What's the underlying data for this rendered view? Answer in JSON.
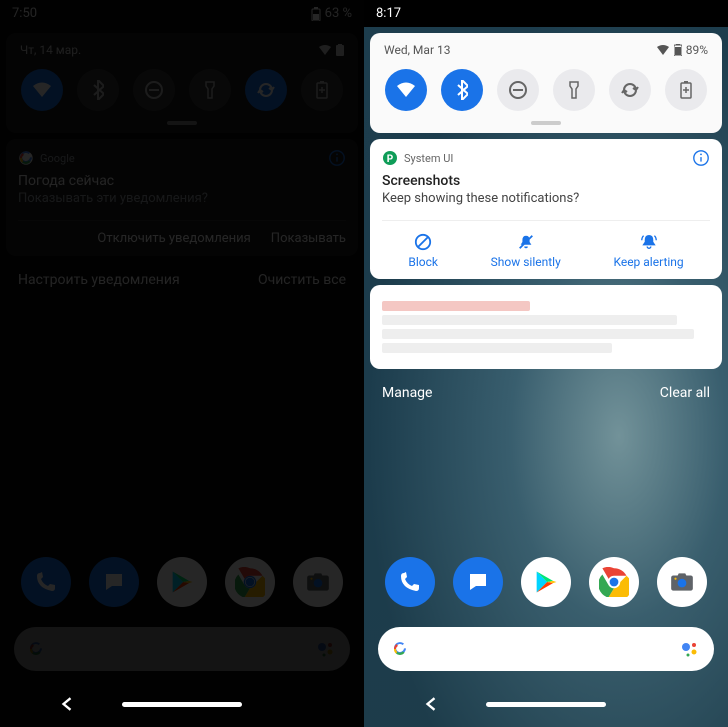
{
  "left": {
    "status": {
      "time": "7:50",
      "battery": "63 %"
    },
    "qs": {
      "date": "Чт, 14 мар.",
      "toggles": [
        {
          "name": "wifi",
          "on": true
        },
        {
          "name": "bluetooth",
          "on": false
        },
        {
          "name": "dnd",
          "on": false
        },
        {
          "name": "flashlight",
          "on": false
        },
        {
          "name": "autorotate",
          "on": true
        },
        {
          "name": "battery-saver",
          "on": false
        }
      ]
    },
    "notif": {
      "app": "Google",
      "title": "Погода сейчас",
      "body": "Показывать эти уведомления?",
      "action1": "Отключить уведомления",
      "action2": "Показывать"
    },
    "footer": {
      "manage": "Настроить уведомления",
      "clear": "Очистить все"
    }
  },
  "right": {
    "status": {
      "time": "8:17",
      "battery": "89%"
    },
    "qs": {
      "date": "Wed, Mar 13",
      "toggles": [
        {
          "name": "wifi",
          "on": true
        },
        {
          "name": "bluetooth",
          "on": true
        },
        {
          "name": "dnd",
          "on": false
        },
        {
          "name": "flashlight",
          "on": false
        },
        {
          "name": "autorotate",
          "on": false
        },
        {
          "name": "battery-saver",
          "on": false
        }
      ]
    },
    "notif": {
      "app": "System UI",
      "title": "Screenshots",
      "body": "Keep showing these notifications?",
      "block": "Block",
      "silent": "Show silently",
      "keep": "Keep alerting"
    },
    "footer": {
      "manage": "Manage",
      "clear": "Clear all"
    }
  }
}
